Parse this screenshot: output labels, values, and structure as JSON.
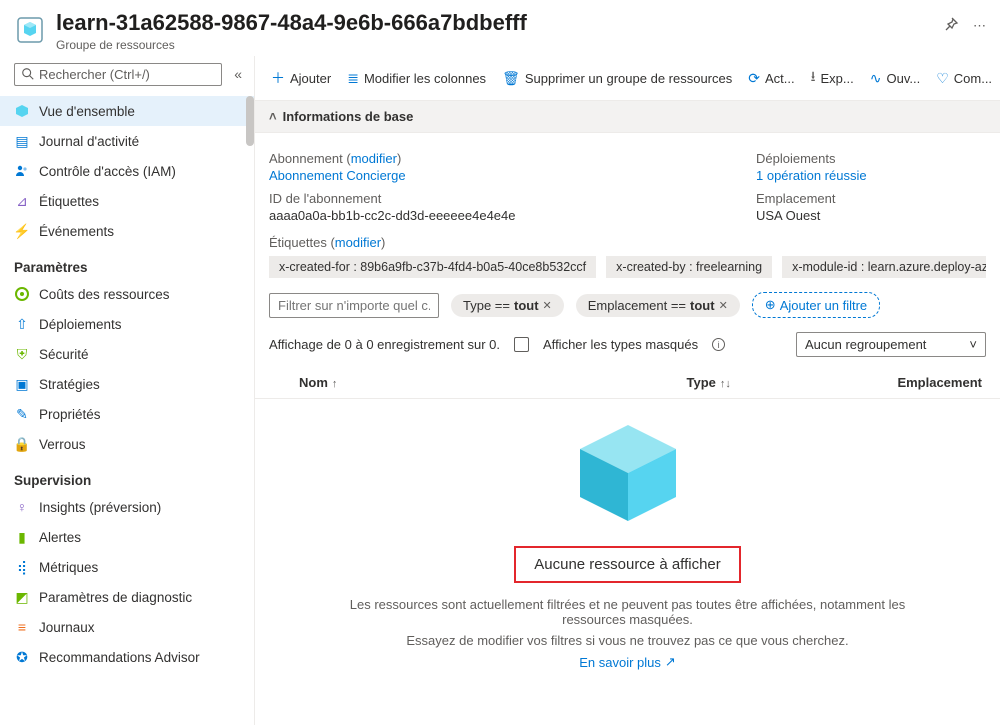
{
  "header": {
    "title": "learn-31a62588-9867-48a4-9e6b-666a7bdbefff",
    "subtitle": "Groupe de ressources"
  },
  "search": {
    "placeholder": "Rechercher (Ctrl+/)"
  },
  "nav": {
    "main": [
      {
        "icon": "cube",
        "label": "Vue d'ensemble",
        "color": "#40c2e8"
      },
      {
        "icon": "log",
        "label": "Journal d'activité",
        "color": "#0078d4"
      },
      {
        "icon": "iam",
        "label": "Contrôle d'accès (IAM)",
        "color": "#0078d4"
      },
      {
        "icon": "tag",
        "label": "Étiquettes",
        "color": "#8661c5"
      },
      {
        "icon": "bolt",
        "label": "Événements",
        "color": "#ffaa00"
      }
    ],
    "paramsTitle": "Paramètres",
    "params": [
      {
        "icon": "cost",
        "label": "Coûts des ressources",
        "color": "#6bb700"
      },
      {
        "icon": "deploy",
        "label": "Déploiements",
        "color": "#0078d4"
      },
      {
        "icon": "shield",
        "label": "Sécurité",
        "color": "#6bb700"
      },
      {
        "icon": "strategy",
        "label": "Stratégies",
        "color": "#0078d4"
      },
      {
        "icon": "props",
        "label": "Propriétés",
        "color": "#0078d4"
      },
      {
        "icon": "lock",
        "label": "Verrous",
        "color": "#605e5c"
      }
    ],
    "supTitle": "Supervision",
    "sup": [
      {
        "icon": "bulb",
        "label": "Insights (préversion)",
        "color": "#8661c5"
      },
      {
        "icon": "alert",
        "label": "Alertes",
        "color": "#6bb700"
      },
      {
        "icon": "metrics",
        "label": "Métriques",
        "color": "#0078d4"
      },
      {
        "icon": "diag",
        "label": "Paramètres de diagnostic",
        "color": "#6bb700"
      },
      {
        "icon": "logs",
        "label": "Journaux",
        "color": "#ef6f1f"
      },
      {
        "icon": "advisor",
        "label": "Recommandations Advisor",
        "color": "#0078d4"
      }
    ]
  },
  "toolbar": {
    "add": "Ajouter",
    "cols": "Modifier les colonnes",
    "del": "Supprimer un groupe de ressources",
    "act": "Act...",
    "exp": "Exp...",
    "ouv": "Ouv...",
    "com": "Com..."
  },
  "info": {
    "head": "Informations de base",
    "sub_lbl": "Abonnement",
    "sub_mod": "modifier",
    "sub_val": "Abonnement Concierge",
    "id_lbl": "ID de l'abonnement",
    "id_val": "aaaa0a0a-bb1b-cc2c-dd3d-eeeeee4e4e4e",
    "tags_lbl": "Étiquettes",
    "tags_mod": "modifier",
    "dep_lbl": "Déploiements",
    "dep_val": "1 opération réussie",
    "emp_lbl": "Emplacement",
    "emp_val": "USA Ouest",
    "tags": [
      "x-created-for : 89b6a9fb-c37b-4fd4-b0a5-40ce8b532ccf",
      "x-created-by : freelearning",
      "x-module-id : learn.azure.deploy-az"
    ]
  },
  "filters": {
    "placeholder": "Filtrer sur n'importe quel c...",
    "type_prefix": "Type == ",
    "type_val": "tout",
    "emp_prefix": "Emplacement == ",
    "emp_val": "tout",
    "add": "Ajouter un filtre"
  },
  "meta": {
    "count": "Affichage de 0 à 0 enregistrement sur 0.",
    "hidden": "Afficher les types masqués",
    "group": "Aucun regroupement"
  },
  "cols": {
    "nom": "Nom",
    "type": "Type",
    "emp": "Emplacement"
  },
  "empty": {
    "title": "Aucune ressource à afficher",
    "l1": "Les ressources sont actuellement filtrées et ne peuvent pas toutes être affichées, notamment les ressources masquées.",
    "l2": "Essayez de modifier vos filtres si vous ne trouvez pas ce que vous cherchez.",
    "learn": "En savoir plus"
  }
}
